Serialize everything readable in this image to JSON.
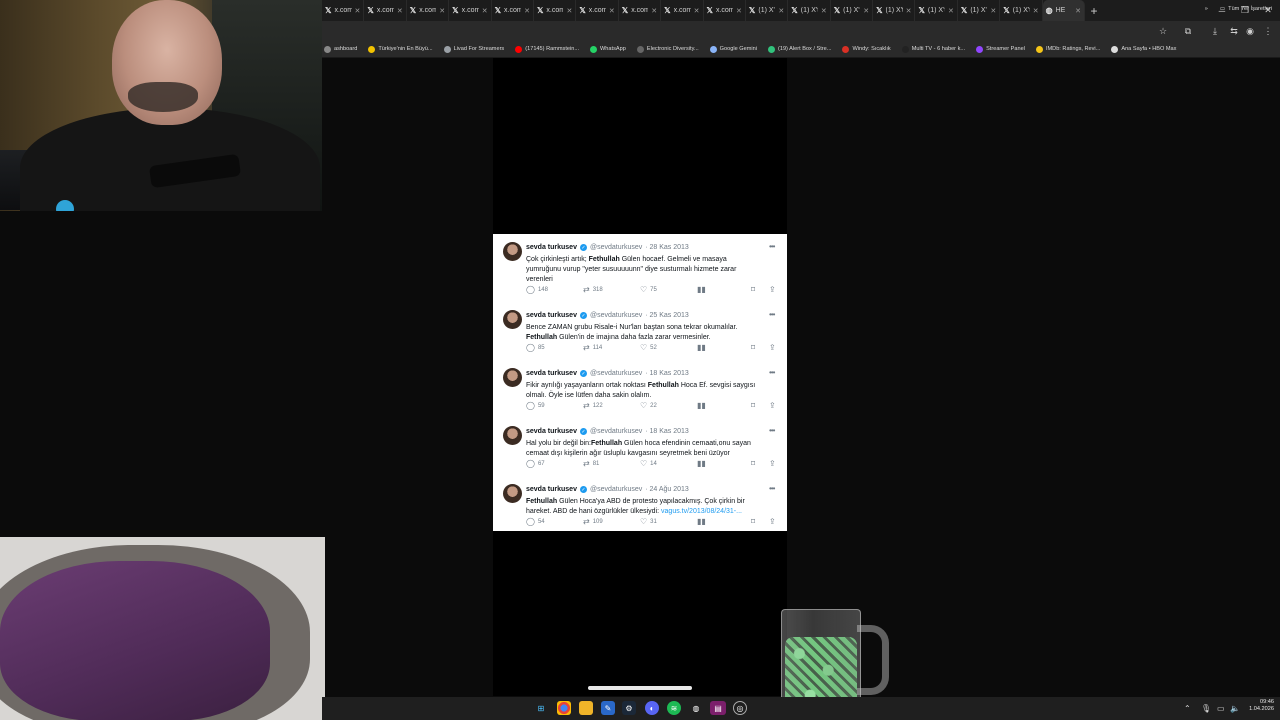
{
  "browser": {
    "tabs": [
      {
        "label": "x.com/",
        "icon": "x-logo-icon"
      },
      {
        "label": "x.com/",
        "icon": "x-logo-icon"
      },
      {
        "label": "x.com/",
        "icon": "x-logo-icon"
      },
      {
        "label": "x.com/",
        "icon": "x-logo-icon"
      },
      {
        "label": "x.com/",
        "icon": "x-logo-icon"
      },
      {
        "label": "x.com/",
        "icon": "x-logo-icon"
      },
      {
        "label": "x.com/",
        "icon": "x-logo-icon"
      },
      {
        "label": "x.com/",
        "icon": "x-logo-icon"
      },
      {
        "label": "x.com/",
        "icon": "x-logo-icon"
      },
      {
        "label": "x.com/",
        "icon": "x-logo-icon"
      },
      {
        "label": "(1) X'te",
        "icon": "x-logo-icon"
      },
      {
        "label": "(1) X'te",
        "icon": "x-logo-icon"
      },
      {
        "label": "(1) X'te",
        "icon": "x-logo-icon"
      },
      {
        "label": "(1) X'te",
        "icon": "x-logo-icon"
      },
      {
        "label": "(1) X'te",
        "icon": "x-logo-icon"
      },
      {
        "label": "(1) X'te",
        "icon": "x-logo-icon"
      },
      {
        "label": "(1) X'te",
        "icon": "x-logo-icon"
      },
      {
        "label": "HE",
        "icon": "globe-icon",
        "active": true
      }
    ],
    "new_tab": "+",
    "bookmarks": [
      {
        "label": "ashboard",
        "color": "#888888"
      },
      {
        "label": "Türkiye'nin En Büyü...",
        "color": "#f2c200"
      },
      {
        "label": "Livad For Streamers",
        "color": "#9aa0a6"
      },
      {
        "label": "(17145) Rammstein...",
        "color": "#ff0000"
      },
      {
        "label": "WhatsApp",
        "color": "#25d366"
      },
      {
        "label": "Electronic Diversity...",
        "color": "#666666"
      },
      {
        "label": "Google Gemini",
        "color": "#8ab4f8"
      },
      {
        "label": "(19) Alert Box / Stre...",
        "color": "#31c27c"
      },
      {
        "label": "Windy: Sıcaklık",
        "color": "#d93025"
      },
      {
        "label": "Multi TV - 6 haber k...",
        "color": "#222222"
      },
      {
        "label": "Streamer Panel",
        "color": "#9146ff"
      },
      {
        "label": "IMDb: Ratings, Revi...",
        "color": "#f5c518"
      },
      {
        "label": "Ana Sayfa • HBO Max",
        "color": "#dddddd"
      }
    ],
    "bookmarks_more": "»",
    "all_bookmarks": "Tüm Yer İşaretleri"
  },
  "tweets": [
    {
      "name": "sevda turkusev",
      "handle": "@sevdaturkusev",
      "date": "· 28 Kas 2013",
      "text_before": "Çok çirkinleşti artık; ",
      "bold": "Fethullah",
      "text_after": " Gülen hocaef. Gelmeli ve masaya yumruğunu vurup \"yeter susuuuuunn\" diye susturmalı hizmete zarar verenleri",
      "link": "",
      "replies": "148",
      "reposts": "318",
      "likes": "75"
    },
    {
      "name": "sevda turkusev",
      "handle": "@sevdaturkusev",
      "date": "· 25 Kas 2013",
      "text_before": "Bence ZAMAN grubu Risale-i Nur'ları baştan sona tekrar okumalılar. ",
      "bold": "Fethullah",
      "text_after": " Gülen'in de imajına daha fazla zarar vermesinler.",
      "link": "",
      "replies": "85",
      "reposts": "114",
      "likes": "52"
    },
    {
      "name": "sevda turkusev",
      "handle": "@sevdaturkusev",
      "date": "· 18 Kas 2013",
      "text_before": "Fikir ayrılığı yaşayanların ortak noktası ",
      "bold": "Fethullah",
      "text_after": " Hoca Ef. sevgisi saygısı olmalı. Öyle ise lütfen daha sakin olalım.",
      "link": "",
      "replies": "59",
      "reposts": "122",
      "likes": "22"
    },
    {
      "name": "sevda turkusev",
      "handle": "@sevdaturkusev",
      "date": "· 18 Kas 2013",
      "text_before": "Hal yolu bir değil bin:",
      "bold": "Fethullah",
      "text_after": " Gülen hoca efendinin cemaati,onu sayan cemaat dışı kişilerin ağır üsluplu  kavgasını seyretmek beni üzüyor",
      "link": "",
      "replies": "67",
      "reposts": "81",
      "likes": "14"
    },
    {
      "name": "sevda turkusev",
      "handle": "@sevdaturkusev",
      "date": "· 24 Ağu 2013",
      "text_before": "",
      "bold": "Fethullah",
      "text_after": " Gülen Hoca'ya ABD de protesto yapılacakmış. Çok çirkin bir hareket. ABD de hani özgürlükler ülkesiydi: ",
      "link": "vagus.tv/2013/08/24/31-...",
      "replies": "54",
      "reposts": "109",
      "likes": "31"
    }
  ],
  "clock": {
    "time": "09:46",
    "date": "1.04.2026"
  }
}
